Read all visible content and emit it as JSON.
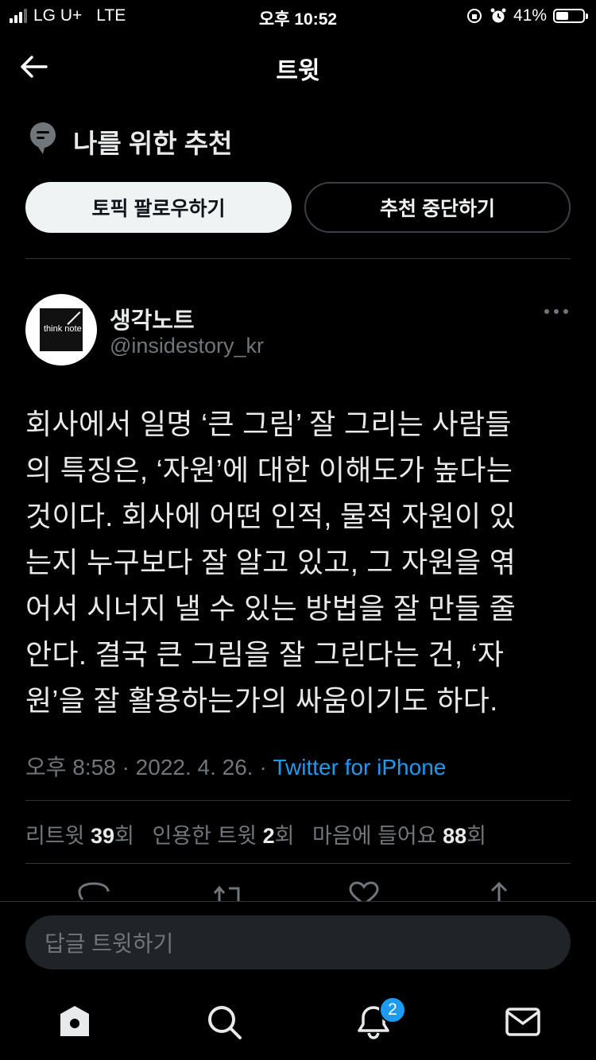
{
  "status_bar": {
    "carrier": "LG U+",
    "network": "LTE",
    "time": "오후 10:52",
    "battery": "41%"
  },
  "header": {
    "title": "트윗"
  },
  "recommendation": {
    "title": "나를 위한 추천",
    "follow_label": "토픽 팔로우하기",
    "stop_label": "추천 중단하기"
  },
  "tweet": {
    "avatar_text": "think note",
    "display_name": "생각노트",
    "handle": "@insidestory_kr",
    "lines": [
      "회사에서 일명 ‘큰 그림’ 잘 그리는 사람들",
      "의 특징은, ‘자원’에 대한 이해도가 높다는",
      "것이다. 회사에 어떤 인적, 물적 자원이 있",
      "는지 누구보다 잘 알고 있고, 그 자원을 엮",
      "어서 시너지 낼 수 있는 방법을 잘 만들 줄",
      "안다. 결국 큰 그림을 잘 그린다는 건, ‘자",
      "원’을 잘 활용하는가의 싸움이기도 하다."
    ],
    "timestamp": "오후 8:58 · 2022. 4. 26. · ",
    "source": "Twitter for iPhone",
    "stats": {
      "retweets_label": "리트윗 ",
      "retweets": "39",
      "retweets_unit": "회",
      "quotes_label": "인용한 트윗 ",
      "quotes": "2",
      "quotes_unit": "회",
      "likes_label": "마음에 들어요 ",
      "likes": "88",
      "likes_unit": "회"
    }
  },
  "reply": {
    "placeholder": "답글 트윗하기"
  },
  "tabbar": {
    "notification_count": "2"
  },
  "colors": {
    "accent": "#1d9bf0",
    "background": "#000000",
    "muted": "#71767b"
  }
}
